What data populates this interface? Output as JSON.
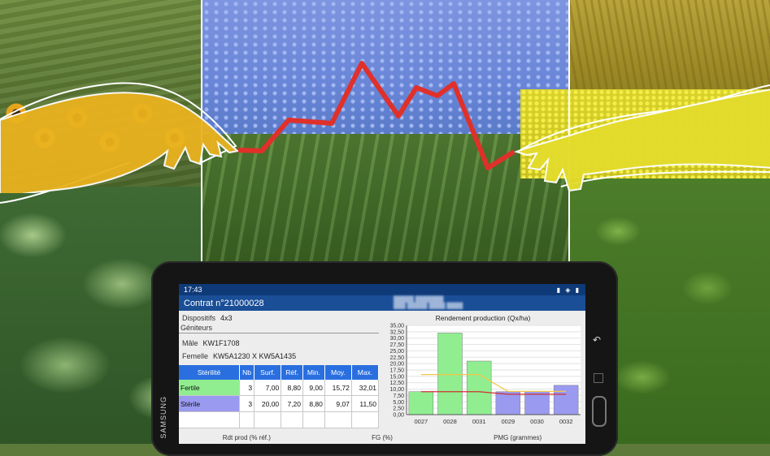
{
  "device": {
    "brand": "SAMSUNG",
    "back_icon": "back-arrow-icon"
  },
  "status_bar": {
    "time": "17:43",
    "icons": "▮ ◈ ▮"
  },
  "app_bar": {
    "title": "Contrat n°21000028"
  },
  "form": {
    "dispositifs_label": "Dispositifs",
    "dispositifs_value": "4x3",
    "geniteurs_label": "Géniteurs",
    "male_label": "Mâle",
    "male_value": "KW1F1708",
    "femelle_label": "Femelle",
    "femelle_value": "KW5A1230 X KW5A1435"
  },
  "table": {
    "headers": [
      "Stérilité",
      "Nb",
      "Surf.",
      "Réf.",
      "Min.",
      "Moy.",
      "Max."
    ],
    "rows": [
      {
        "name": "Fertile",
        "nb": "3",
        "surf": "7,00",
        "ref": "8,80",
        "min": "9,00",
        "moy": "15,72",
        "max": "32,01"
      },
      {
        "name": "Stérile",
        "nb": "3",
        "surf": "20,00",
        "ref": "7,20",
        "min": "8,80",
        "moy": "9,07",
        "max": "11,50"
      }
    ]
  },
  "chart_data": {
    "type": "bar",
    "title": "Rendement production (Qx/ha)",
    "categories": [
      "0027",
      "0028",
      "0031",
      "0029",
      "0030",
      "0032"
    ],
    "ylim": [
      0,
      35
    ],
    "yticks": [
      "0,00",
      "2,50",
      "5,00",
      "7,50",
      "10,00",
      "12,50",
      "15,00",
      "17,50",
      "20,00",
      "22,50",
      "25,00",
      "27,50",
      "30,00",
      "32,50",
      "35,00"
    ],
    "series": [
      {
        "name": "",
        "values": [
          9.0,
          32.0,
          21.0,
          9.0,
          9.0,
          11.5
        ]
      },
      {
        "name": "",
        "line": true,
        "values": [
          15.7,
          15.7,
          15.7,
          9.1,
          9.1,
          9.1
        ]
      },
      {
        "name": "",
        "line": true,
        "values": [
          9.0,
          9.0,
          9.0,
          8.0,
          8.0,
          8.0
        ]
      }
    ],
    "colors": {
      "fertile": "#90ee90",
      "sterile": "#9a9af0",
      "fertile_line": "#f0c84a",
      "sterile_line": "#d03030"
    },
    "grid": true
  },
  "footer": {
    "col1": "Rdt prod (% réf.)",
    "col2": "FG (%)",
    "col3": "PMG (grammes)"
  },
  "colors": {
    "accent_line": "#e0302a",
    "status_bar": "#0e3a78",
    "app_bar": "#1a4e96",
    "table_header": "#2a6fe0"
  }
}
